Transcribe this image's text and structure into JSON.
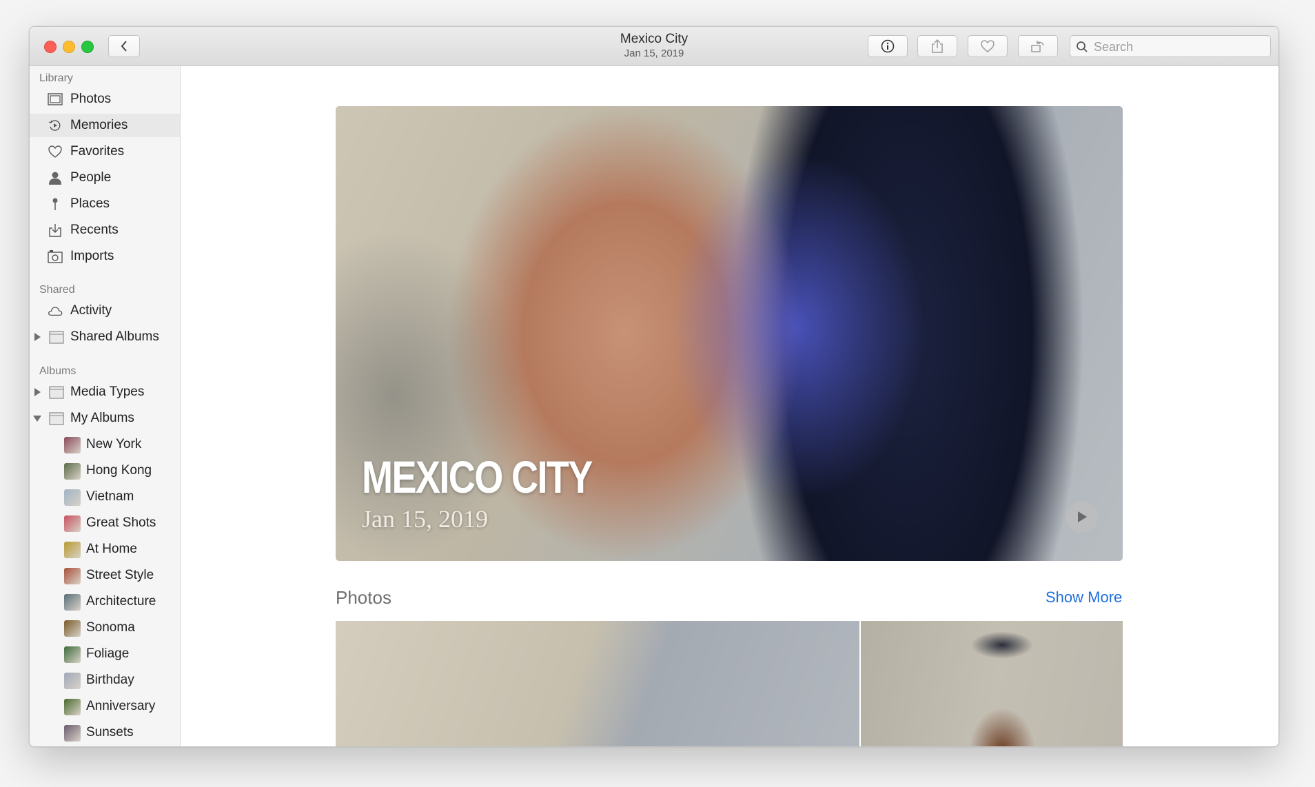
{
  "window": {
    "title": "Mexico City",
    "subtitle": "Jan 15, 2019"
  },
  "toolbar": {
    "back_icon": "chevron-left-icon",
    "info_icon": "info-icon",
    "share_icon": "share-icon",
    "favorite_icon": "heart-icon",
    "rotate_icon": "rotate-icon",
    "search_placeholder": "Search"
  },
  "sidebar": {
    "library_heading": "Library",
    "library_items": [
      {
        "label": "Photos",
        "icon": "photos-icon"
      },
      {
        "label": "Memories",
        "icon": "memories-icon",
        "selected": true
      },
      {
        "label": "Favorites",
        "icon": "heart-icon"
      },
      {
        "label": "People",
        "icon": "person-icon"
      },
      {
        "label": "Places",
        "icon": "pin-icon"
      },
      {
        "label": "Recents",
        "icon": "recents-icon"
      },
      {
        "label": "Imports",
        "icon": "camera-icon"
      }
    ],
    "shared_heading": "Shared",
    "shared_items": [
      {
        "label": "Activity",
        "icon": "cloud-icon"
      },
      {
        "label": "Shared Albums",
        "icon": "folder-icon",
        "disclosure": "collapsed"
      }
    ],
    "albums_heading": "Albums",
    "album_groups": [
      {
        "label": "Media Types",
        "icon": "folder-icon",
        "disclosure": "collapsed"
      },
      {
        "label": "My Albums",
        "icon": "folder-icon",
        "disclosure": "expanded"
      }
    ],
    "my_albums": [
      {
        "label": "New York",
        "color": "#8a4a5a"
      },
      {
        "label": "Hong Kong",
        "color": "#5c6b4a"
      },
      {
        "label": "Vietnam",
        "color": "#9fb3c4"
      },
      {
        "label": "Great Shots",
        "color": "#c8505e"
      },
      {
        "label": "At Home",
        "color": "#b89a2e"
      },
      {
        "label": "Street Style",
        "color": "#a8503a"
      },
      {
        "label": "Architecture",
        "color": "#5a6e7a"
      },
      {
        "label": "Sonoma",
        "color": "#7a5a2a"
      },
      {
        "label": "Foliage",
        "color": "#3e6a3a"
      },
      {
        "label": "Birthday",
        "color": "#a0a8b8"
      },
      {
        "label": "Anniversary",
        "color": "#4a6a2e"
      },
      {
        "label": "Sunsets",
        "color": "#6a5a6e"
      }
    ]
  },
  "memory": {
    "title": "MEXICO CITY",
    "date": "Jan 15, 2019",
    "play_icon": "play-icon"
  },
  "photos_section": {
    "title": "Photos",
    "show_more": "Show More"
  },
  "colors": {
    "accent": "#1f6fdc",
    "sidebar_bg": "#f5f5f5",
    "selection_bg": "#e8e8e8"
  }
}
